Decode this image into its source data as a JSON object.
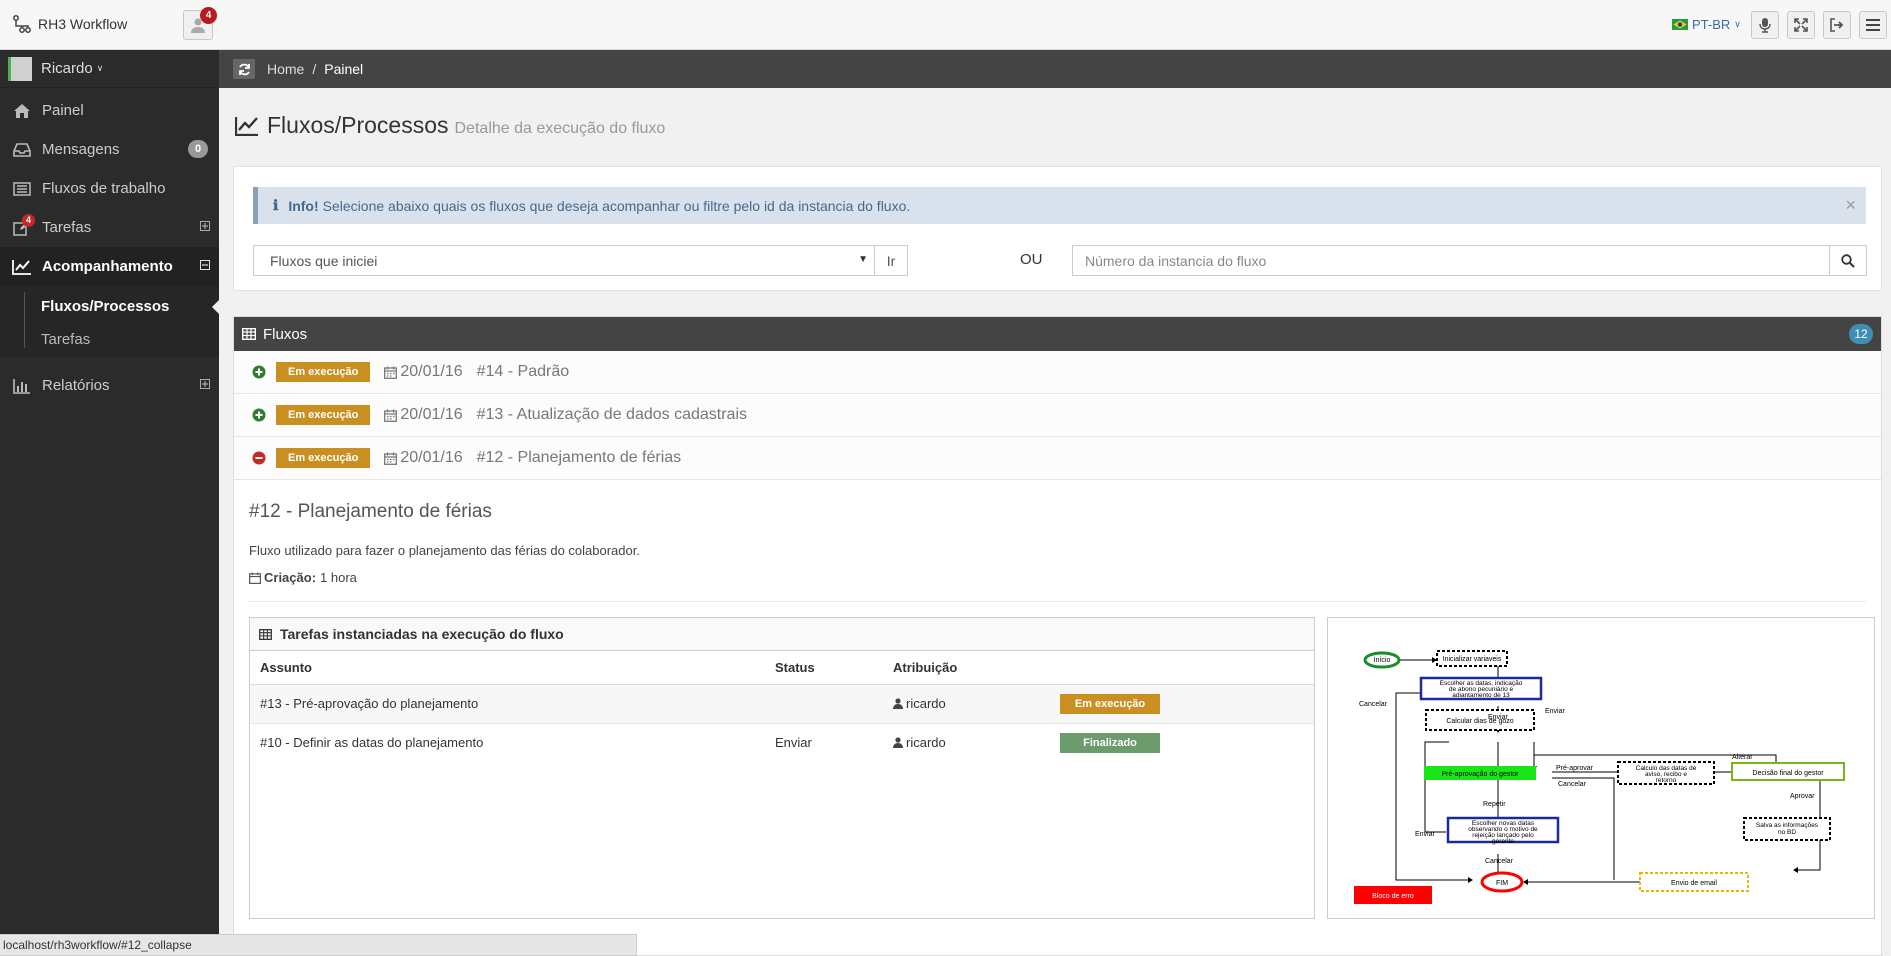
{
  "app": {
    "title": "RH3 Workflow",
    "notif_count": "4",
    "lang": "PT-BR"
  },
  "sidebar": {
    "user": "Ricardo",
    "items": [
      {
        "label": "Painel",
        "icon": "home-icon"
      },
      {
        "label": "Mensagens",
        "icon": "inbox-icon",
        "badge": "0"
      },
      {
        "label": "Fluxos de trabalho",
        "icon": "list-icon"
      },
      {
        "label": "Tarefas",
        "icon": "edit-icon",
        "badge": "4"
      },
      {
        "label": "Acompanhamento",
        "icon": "chart-icon"
      },
      {
        "label": "Relatórios",
        "icon": "bar-chart-icon"
      }
    ],
    "subitems": [
      {
        "label": "Fluxos/Processos"
      },
      {
        "label": "Tarefas"
      }
    ]
  },
  "breadcrumb": {
    "home": "Home",
    "sep": "/",
    "current": "Painel"
  },
  "page": {
    "title": "Fluxos/Processos",
    "subtitle": "Detalhe da execução do fluxo"
  },
  "filter": {
    "info_label": "Info!",
    "info_text": "Selecione abaixo quais os fluxos que deseja acompanhar ou filtre pelo id da instancia do fluxo.",
    "select_value": "Fluxos que iniciei",
    "go_label": "Ir",
    "or_label": "OU",
    "instance_placeholder": "Número da instancia do fluxo"
  },
  "fluxos": {
    "title": "Fluxos",
    "count": "12",
    "rows": [
      {
        "status": "Em execução",
        "date": "20/01/16",
        "name": "#14 - Padrão"
      },
      {
        "status": "Em execução",
        "date": "20/01/16",
        "name": "#13 - Atualização de dados cadastrais"
      },
      {
        "status": "Em execução",
        "date": "20/01/16",
        "name": "#12 - Planejamento de férias"
      }
    ],
    "detail": {
      "title": "#12 - Planejamento de férias",
      "description": "Fluxo utilizado para fazer o planejamento das férias do colaborador.",
      "creation_label": "Criação:",
      "creation_value": "1 hora"
    },
    "tasks": {
      "title": "Tarefas instanciadas na execução do fluxo",
      "headers": [
        "Assunto",
        "Status",
        "Atribuição"
      ],
      "rows": [
        {
          "subject": "#13 - Pré-aprovação do planejamento",
          "status": "",
          "assignee": "ricardo",
          "badge": "Em execução"
        },
        {
          "subject": "#10 - Definir as datas do planejamento",
          "status": "Enviar",
          "assignee": "ricardo",
          "badge": "Finalizado"
        }
      ]
    }
  },
  "diagram": {
    "start": "Início",
    "init_vars": "Inicializar variaveis",
    "choose_dates_1": "Escolher as datas, indicação",
    "choose_dates_2": "de abono pecuniário e",
    "choose_dates_3": "adiantamento de 13",
    "calc_days": "Calcular dias de gozo",
    "pre_approval": "Pré-aprovação do gestor",
    "calc_dates_1": "Calculo das datas de",
    "calc_dates_2": "aviso, recibo e",
    "calc_dates_3": "retorno",
    "final_decision": "Decisão final do gestor",
    "new_dates_1": "Escolher novas datas",
    "new_dates_2": "observando o motivo de",
    "new_dates_3": "rejeição lançado pelo",
    "new_dates_4": "gerente",
    "save_info_1": "Salva as informações",
    "save_info_2": "no BD",
    "error_block": "Bloco de erro",
    "end": "FIM",
    "send_email": "Envio de email",
    "lbl_cancelar": "Cancelar",
    "lbl_enviar": "Enviar",
    "lbl_pre_aprovar": "Pré-aprovar",
    "lbl_alterar": "Alterar",
    "lbl_aprovar": "Aprovar",
    "lbl_repetir": "Repetir"
  },
  "statusbar": {
    "url": "localhost/rh3workflow/#12_collapse"
  }
}
